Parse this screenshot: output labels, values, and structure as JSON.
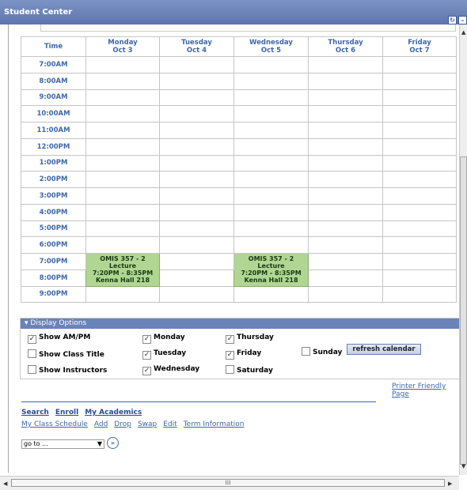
{
  "window": {
    "title": "Student Center"
  },
  "calendar": {
    "headers": [
      {
        "l1": "Time",
        "l2": ""
      },
      {
        "l1": "Monday",
        "l2": "Oct 3"
      },
      {
        "l1": "Tuesday",
        "l2": "Oct 4"
      },
      {
        "l1": "Wednesday",
        "l2": "Oct 5"
      },
      {
        "l1": "Thursday",
        "l2": "Oct 6"
      },
      {
        "l1": "Friday",
        "l2": "Oct 7"
      }
    ],
    "times": [
      "7:00AM",
      "8:00AM",
      "9:00AM",
      "10:00AM",
      "11:00AM",
      "12:00PM",
      "1:00PM",
      "2:00PM",
      "3:00PM",
      "4:00PM",
      "5:00PM",
      "6:00PM",
      "7:00PM",
      "8:00PM",
      "9:00PM"
    ],
    "event": {
      "course": "OMIS 357 - 2",
      "type": "Lecture",
      "time": "7:20PM - 8:35PM",
      "room": "Kenna Hall 218"
    }
  },
  "display_options": {
    "title": "Display Options",
    "show_ampm": "Show AM/PM",
    "show_class_title": "Show Class Title",
    "show_instructors": "Show Instructors",
    "monday": "Monday",
    "tuesday": "Tuesday",
    "wednesday": "Wednesday",
    "thursday": "Thursday",
    "friday": "Friday",
    "saturday": "Saturday",
    "sunday": "Sunday",
    "refresh": "refresh calendar"
  },
  "printer_friendly": "Printer Friendly Page",
  "nav": {
    "row1": [
      "Search",
      "Enroll",
      "My Academics"
    ],
    "row2": [
      "My Class Schedule",
      "Add",
      "Drop",
      "Swap",
      "Edit",
      "Term Information"
    ]
  },
  "goto": {
    "value": "go to ..."
  }
}
